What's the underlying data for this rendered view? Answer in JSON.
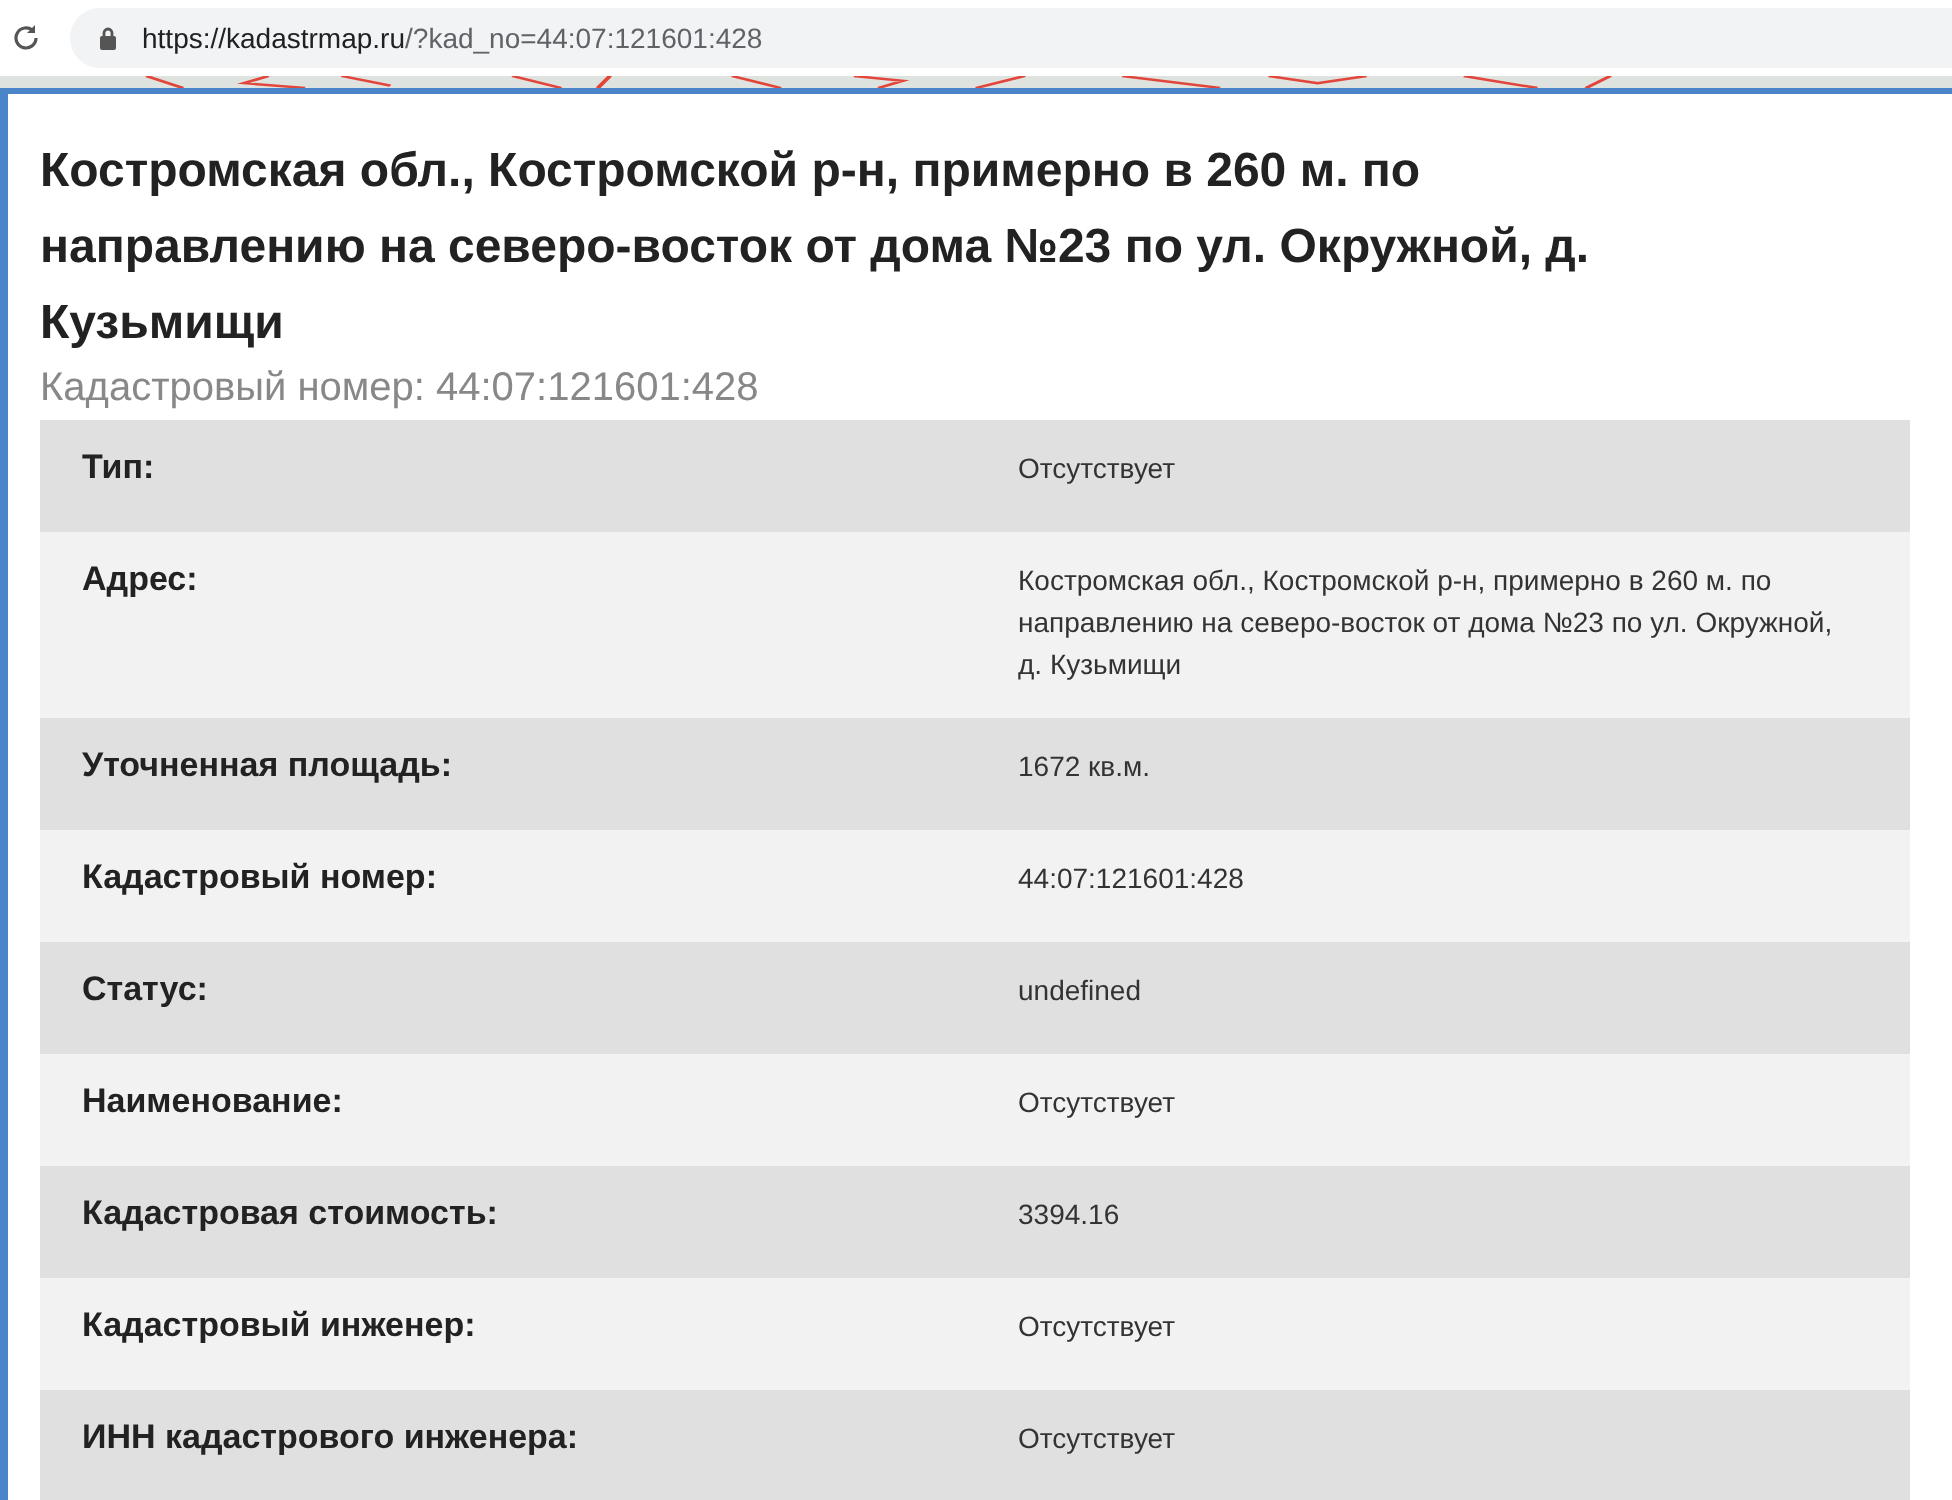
{
  "browser": {
    "url_host": "https://kadastrmap.ru",
    "url_path": "/?kad_no=44:07:121601:428"
  },
  "title": "Костромская обл., Костромской р-н, примерно в 260 м. по направлению на северо-восток от дома №23 по ул. Окружной, д. Кузьмищи",
  "subtitle": "Кадастровый номер: 44:07:121601:428",
  "table": {
    "rows": [
      {
        "label": "Тип:",
        "value": "Отсутствует"
      },
      {
        "label": "Адрес:",
        "value": "Костромская обл., Костромской р-н, примерно в 260 м. по направлению на северо-восток от дома №23 по ул. Окружной, д. Кузьмищи"
      },
      {
        "label": "Уточненная площадь:",
        "value": "1672 кв.м."
      },
      {
        "label": "Кадастровый номер:",
        "value": "44:07:121601:428"
      },
      {
        "label": "Статус:",
        "value": "undefined"
      },
      {
        "label": "Наименование:",
        "value": "Отсутствует"
      },
      {
        "label": "Кадастровая стоимость:",
        "value": "3394.16"
      },
      {
        "label": "Кадастровый инженер:",
        "value": "Отсутствует"
      },
      {
        "label": "ИНН кадастрового инженера:",
        "value": "Отсутствует"
      }
    ]
  }
}
